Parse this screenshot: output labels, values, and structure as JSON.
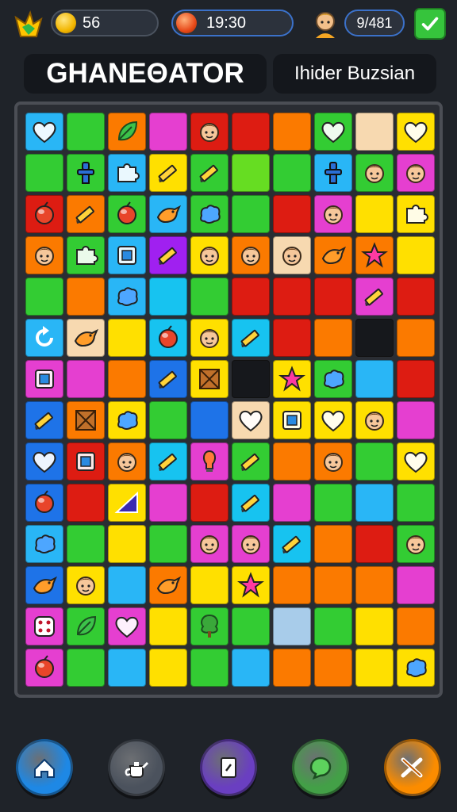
{
  "header": {
    "coins": "56",
    "timer": "19:30",
    "score": "9/481",
    "title": "GHANEΘATOR",
    "subtitle": "Ihider Buzsian"
  },
  "colors": {
    "Bl": "#29b6f6",
    "G": "#33cc33",
    "Y": "#ffe000",
    "M": "#e53fd0",
    "R": "#dd1c12",
    "O": "#fb7a00",
    "Lg": "#66dd22",
    "C": "#17c3f0",
    "P": "#a020f0",
    "Db": "#1e73e8",
    "Pe": "#f7d9b0",
    "Gr": "#a8ccea",
    "K": "#16181c"
  },
  "board": {
    "rows": [
      [
        {
          "c": "Bl",
          "i": "heart"
        },
        {
          "c": "G"
        },
        {
          "c": "O",
          "i": "leaf"
        },
        {
          "c": "M"
        },
        {
          "c": "R",
          "i": "face"
        },
        {
          "c": "R"
        },
        {
          "c": "O"
        },
        {
          "c": "G",
          "i": "heart"
        },
        {
          "c": "Pe"
        },
        {
          "c": "Y",
          "i": "heart"
        }
      ],
      [
        {
          "c": "G"
        },
        {
          "c": "G",
          "i": "figure"
        },
        {
          "c": "Bl",
          "i": "puzzle"
        },
        {
          "c": "Y",
          "i": "pencil"
        },
        {
          "c": "G",
          "i": "pencil"
        },
        {
          "c": "Lg"
        },
        {
          "c": "G"
        },
        {
          "c": "Bl",
          "i": "figure"
        },
        {
          "c": "G",
          "i": "face"
        },
        {
          "c": "M",
          "i": "face"
        }
      ],
      [
        {
          "c": "R",
          "i": "ball"
        },
        {
          "c": "O",
          "i": "pencil"
        },
        {
          "c": "G",
          "i": "ball"
        },
        {
          "c": "Bl",
          "i": "bird"
        },
        {
          "c": "G",
          "i": "blob"
        },
        {
          "c": "G"
        },
        {
          "c": "R"
        },
        {
          "c": "M",
          "i": "face"
        },
        {
          "c": "Y"
        },
        {
          "c": "Y",
          "i": "puzzle"
        }
      ],
      [
        {
          "c": "O",
          "i": "face"
        },
        {
          "c": "G",
          "i": "puzzle"
        },
        {
          "c": "Bl",
          "i": "box"
        },
        {
          "c": "P",
          "i": "pencil"
        },
        {
          "c": "Y",
          "i": "face"
        },
        {
          "c": "O",
          "i": "face"
        },
        {
          "c": "Pe",
          "i": "face"
        },
        {
          "c": "O",
          "i": "bird"
        },
        {
          "c": "O",
          "i": "star"
        },
        {
          "c": "Y"
        }
      ],
      [
        {
          "c": "G"
        },
        {
          "c": "O"
        },
        {
          "c": "Bl",
          "i": "blob"
        },
        {
          "c": "C"
        },
        {
          "c": "G"
        },
        {
          "c": "R"
        },
        {
          "c": "R"
        },
        {
          "c": "R"
        },
        {
          "c": "M",
          "i": "pencil"
        },
        {
          "c": "R"
        }
      ],
      [
        {
          "c": "Bl",
          "i": "refresh"
        },
        {
          "c": "Pe",
          "i": "bird"
        },
        {
          "c": "Y"
        },
        {
          "c": "C",
          "i": "ball"
        },
        {
          "c": "Y",
          "i": "face"
        },
        {
          "c": "C",
          "i": "pencil"
        },
        {
          "c": "R"
        },
        {
          "c": "O"
        },
        {
          "c": "K"
        },
        {
          "c": "O"
        }
      ],
      [
        {
          "c": "M",
          "i": "box"
        },
        {
          "c": "M"
        },
        {
          "c": "O"
        },
        {
          "c": "Db",
          "i": "pencil"
        },
        {
          "c": "Y",
          "i": "crate"
        },
        {
          "c": "K"
        },
        {
          "c": "Y",
          "i": "star"
        },
        {
          "c": "G",
          "i": "blob"
        },
        {
          "c": "Bl"
        },
        {
          "c": "R"
        }
      ],
      [
        {
          "c": "Db",
          "i": "pencil"
        },
        {
          "c": "O",
          "i": "crate"
        },
        {
          "c": "Y",
          "i": "blob"
        },
        {
          "c": "G"
        },
        {
          "c": "Db"
        },
        {
          "c": "Pe",
          "i": "heart"
        },
        {
          "c": "Y",
          "i": "box"
        },
        {
          "c": "Y",
          "i": "heart"
        },
        {
          "c": "Y",
          "i": "face"
        },
        {
          "c": "M"
        }
      ],
      [
        {
          "c": "Db",
          "i": "heart"
        },
        {
          "c": "R",
          "i": "box"
        },
        {
          "c": "O",
          "i": "face"
        },
        {
          "c": "C",
          "i": "pencil"
        },
        {
          "c": "M",
          "i": "bulb"
        },
        {
          "c": "G",
          "i": "pencil"
        },
        {
          "c": "O"
        },
        {
          "c": "O",
          "i": "face"
        },
        {
          "c": "G"
        },
        {
          "c": "Y",
          "i": "heart"
        }
      ],
      [
        {
          "c": "Db",
          "i": "ball"
        },
        {
          "c": "R"
        },
        {
          "c": "Y",
          "i": "triangle"
        },
        {
          "c": "M"
        },
        {
          "c": "R"
        },
        {
          "c": "C",
          "i": "pencil"
        },
        {
          "c": "M"
        },
        {
          "c": "G"
        },
        {
          "c": "Bl"
        },
        {
          "c": "G"
        }
      ],
      [
        {
          "c": "Bl",
          "i": "blob"
        },
        {
          "c": "G"
        },
        {
          "c": "Y"
        },
        {
          "c": "G"
        },
        {
          "c": "M",
          "i": "face"
        },
        {
          "c": "M",
          "i": "face"
        },
        {
          "c": "C",
          "i": "pencil"
        },
        {
          "c": "O"
        },
        {
          "c": "R"
        },
        {
          "c": "G",
          "i": "face"
        }
      ],
      [
        {
          "c": "Db",
          "i": "bird"
        },
        {
          "c": "Y",
          "i": "face"
        },
        {
          "c": "Bl"
        },
        {
          "c": "O",
          "i": "bird"
        },
        {
          "c": "Y"
        },
        {
          "c": "Y",
          "i": "star"
        },
        {
          "c": "O"
        },
        {
          "c": "O"
        },
        {
          "c": "O"
        },
        {
          "c": "M"
        }
      ],
      [
        {
          "c": "M",
          "i": "dice"
        },
        {
          "c": "G",
          "i": "leaf"
        },
        {
          "c": "M",
          "i": "heart"
        },
        {
          "c": "Y"
        },
        {
          "c": "G",
          "i": "tree"
        },
        {
          "c": "G"
        },
        {
          "c": "Gr"
        },
        {
          "c": "G"
        },
        {
          "c": "Y"
        },
        {
          "c": "O"
        }
      ],
      [
        {
          "c": "M",
          "i": "ball"
        },
        {
          "c": "G"
        },
        {
          "c": "Bl"
        },
        {
          "c": "Y"
        },
        {
          "c": "G"
        },
        {
          "c": "Bl"
        },
        {
          "c": "O"
        },
        {
          "c": "O"
        },
        {
          "c": "Y"
        },
        {
          "c": "Y",
          "i": "blob"
        }
      ]
    ]
  },
  "nav": {
    "items": [
      {
        "name": "home",
        "icon": "home-icon",
        "color": "#1e88e5"
      },
      {
        "name": "shop",
        "icon": "teapot-icon",
        "color": "#4b525d"
      },
      {
        "name": "cards",
        "icon": "card-icon",
        "color": "#6a3fc1"
      },
      {
        "name": "social",
        "icon": "chat-icon",
        "color": "#43a047"
      },
      {
        "name": "tools",
        "icon": "tools-icon",
        "color": "#fb8c00"
      }
    ]
  }
}
